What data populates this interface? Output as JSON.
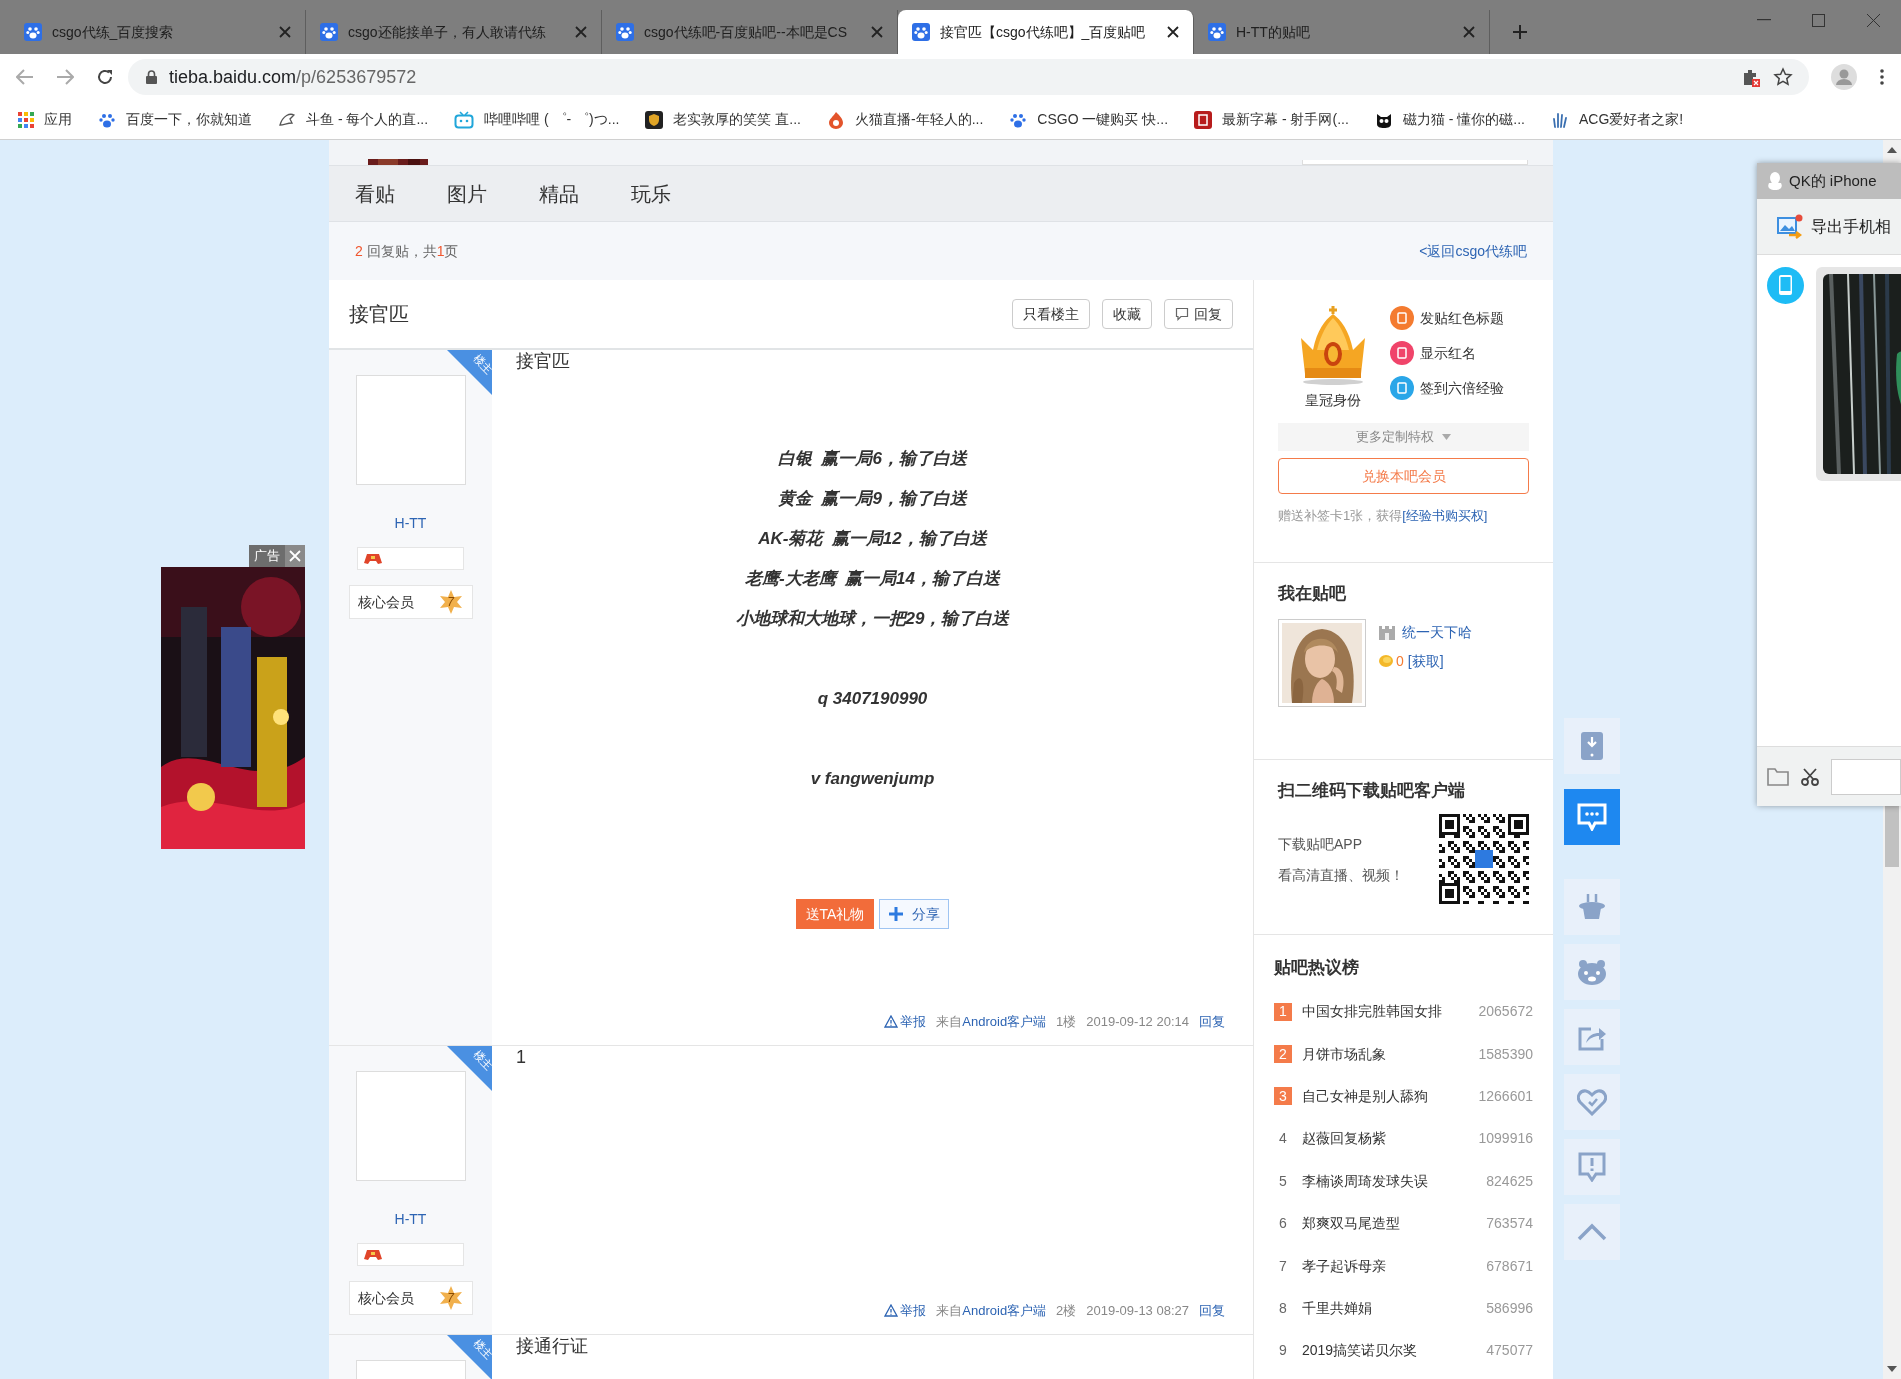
{
  "browser": {
    "tabs": [
      {
        "title": "csgo代练_百度搜索",
        "selected": false
      },
      {
        "title": "csgo还能接单子，有人敢请代练",
        "selected": false
      },
      {
        "title": "csgo代练吧-百度贴吧--本吧是CS",
        "selected": false
      },
      {
        "title": "接官匹【csgo代练吧】_百度贴吧",
        "selected": true
      },
      {
        "title": "H-TT的贴吧",
        "selected": false
      }
    ],
    "address": {
      "host": "tieba.baidu.com",
      "path": "/p/6253679572"
    },
    "bookmarks": [
      "应用",
      "百度一下，你就知道",
      "斗鱼 - 每个人的直...",
      "哔哩哔哩 ( ゜- ゜)つ...",
      "老实敦厚的笑笑 直...",
      "火猫直播-年轻人的...",
      "CSGO 一键购买 快...",
      "最新字幕 - 射手网(...",
      "磁力猫 - 懂你的磁...",
      "ACG爱好者之家!"
    ]
  },
  "ad": {
    "label": "广告"
  },
  "forum_nav": {
    "tabs": [
      "看贴",
      "图片",
      "精品",
      "玩乐"
    ]
  },
  "thread_info": {
    "reply_count": "2",
    "reply_label": "回复贴，共",
    "page_count": "1",
    "page_label": "页",
    "back_link": "<返回csgo代练吧"
  },
  "thread": {
    "title": "接官匹",
    "buttons": [
      {
        "label": "只看楼主",
        "kind": "plain"
      },
      {
        "label": "收藏",
        "kind": "plain"
      },
      {
        "label": "回复",
        "kind": "reply"
      }
    ]
  },
  "posts": [
    {
      "author": "H-TT",
      "op_badge": "楼主",
      "member_label": "核心会员",
      "member_level": "7",
      "text": "接官匹",
      "groups": [
        [
          "白银  赢一局6，输了白送",
          "黄金  赢一局9，输了白送",
          "AK-菊花  赢一局12，输了白送",
          "老鹰-大老鹰  赢一局14，输了白送",
          "小地球和大地球，一把29，输了白送"
        ],
        [
          "q 3407190990"
        ],
        [
          "v fangwenjump"
        ]
      ],
      "gift_button": "送TA礼物",
      "share_button": "分享",
      "footer": {
        "report": "举报",
        "source_label": "来自",
        "source": "Android客户端",
        "floor": "1楼",
        "time": "2019-09-12 20:14",
        "reply": "回复"
      }
    },
    {
      "author": "H-TT",
      "op_badge": "楼主",
      "member_label": "核心会员",
      "member_level": "7",
      "text": "1",
      "footer": {
        "report": "举报",
        "source_label": "来自",
        "source": "Android客户端",
        "floor": "2楼",
        "time": "2019-09-13 08:27",
        "reply": "回复"
      }
    },
    {
      "op_badge": "楼主",
      "text": "接通行证"
    }
  ],
  "sidebar": {
    "crown": {
      "label": "皇冠身份",
      "perks": [
        "发贴红色标题",
        "显示红名",
        "签到六倍经验"
      ],
      "more": "更多定制特权",
      "button": "兑换本吧会员",
      "note_text": "赠送补签卡1张，获得",
      "note_link": "[经验书购买权]"
    },
    "me": {
      "title": "我在贴吧",
      "forum": "统一天下哈",
      "coins": "0",
      "get_link": "[获取]"
    },
    "app": {
      "title": "扫二维码下载贴吧客户端",
      "lines": [
        "下载贴吧APP",
        "看高清直播、视频！"
      ]
    },
    "hot": {
      "title": "贴吧热议榜",
      "items": [
        {
          "rank": "1",
          "topic": "中国女排完胜韩国女排",
          "count": "2065672",
          "highlighted": true
        },
        {
          "rank": "2",
          "topic": "月饼市场乱象",
          "count": "1585390",
          "highlighted": true
        },
        {
          "rank": "3",
          "topic": "自己女神是别人舔狗",
          "count": "1266601",
          "highlighted": true
        },
        {
          "rank": "4",
          "topic": "赵薇回复杨紫",
          "count": "1099916",
          "highlighted": false
        },
        {
          "rank": "5",
          "topic": "李楠谈周琦发球失误",
          "count": "824625",
          "highlighted": false
        },
        {
          "rank": "6",
          "topic": "郑爽双马尾造型",
          "count": "763574",
          "highlighted": false
        },
        {
          "rank": "7",
          "topic": "孝子起诉母亲",
          "count": "678671",
          "highlighted": false
        },
        {
          "rank": "8",
          "topic": "千里共婵娟",
          "count": "586996",
          "highlighted": false
        },
        {
          "rank": "9",
          "topic": "2019搞笑诺贝尔奖",
          "count": "475077",
          "highlighted": false
        }
      ]
    }
  },
  "toolbar": [
    {
      "kind": "download",
      "highlighted": false
    },
    {
      "kind": "message",
      "highlighted": true
    },
    {
      "kind": "hat",
      "highlighted": false
    },
    {
      "kind": "bear",
      "highlighted": false
    },
    {
      "kind": "share",
      "highlighted": false
    },
    {
      "kind": "heart",
      "highlighted": false
    },
    {
      "kind": "report",
      "highlighted": false
    },
    {
      "kind": "top",
      "highlighted": false
    }
  ],
  "qq_window": {
    "title": "QK的 iPhone",
    "action": "导出手机相"
  }
}
